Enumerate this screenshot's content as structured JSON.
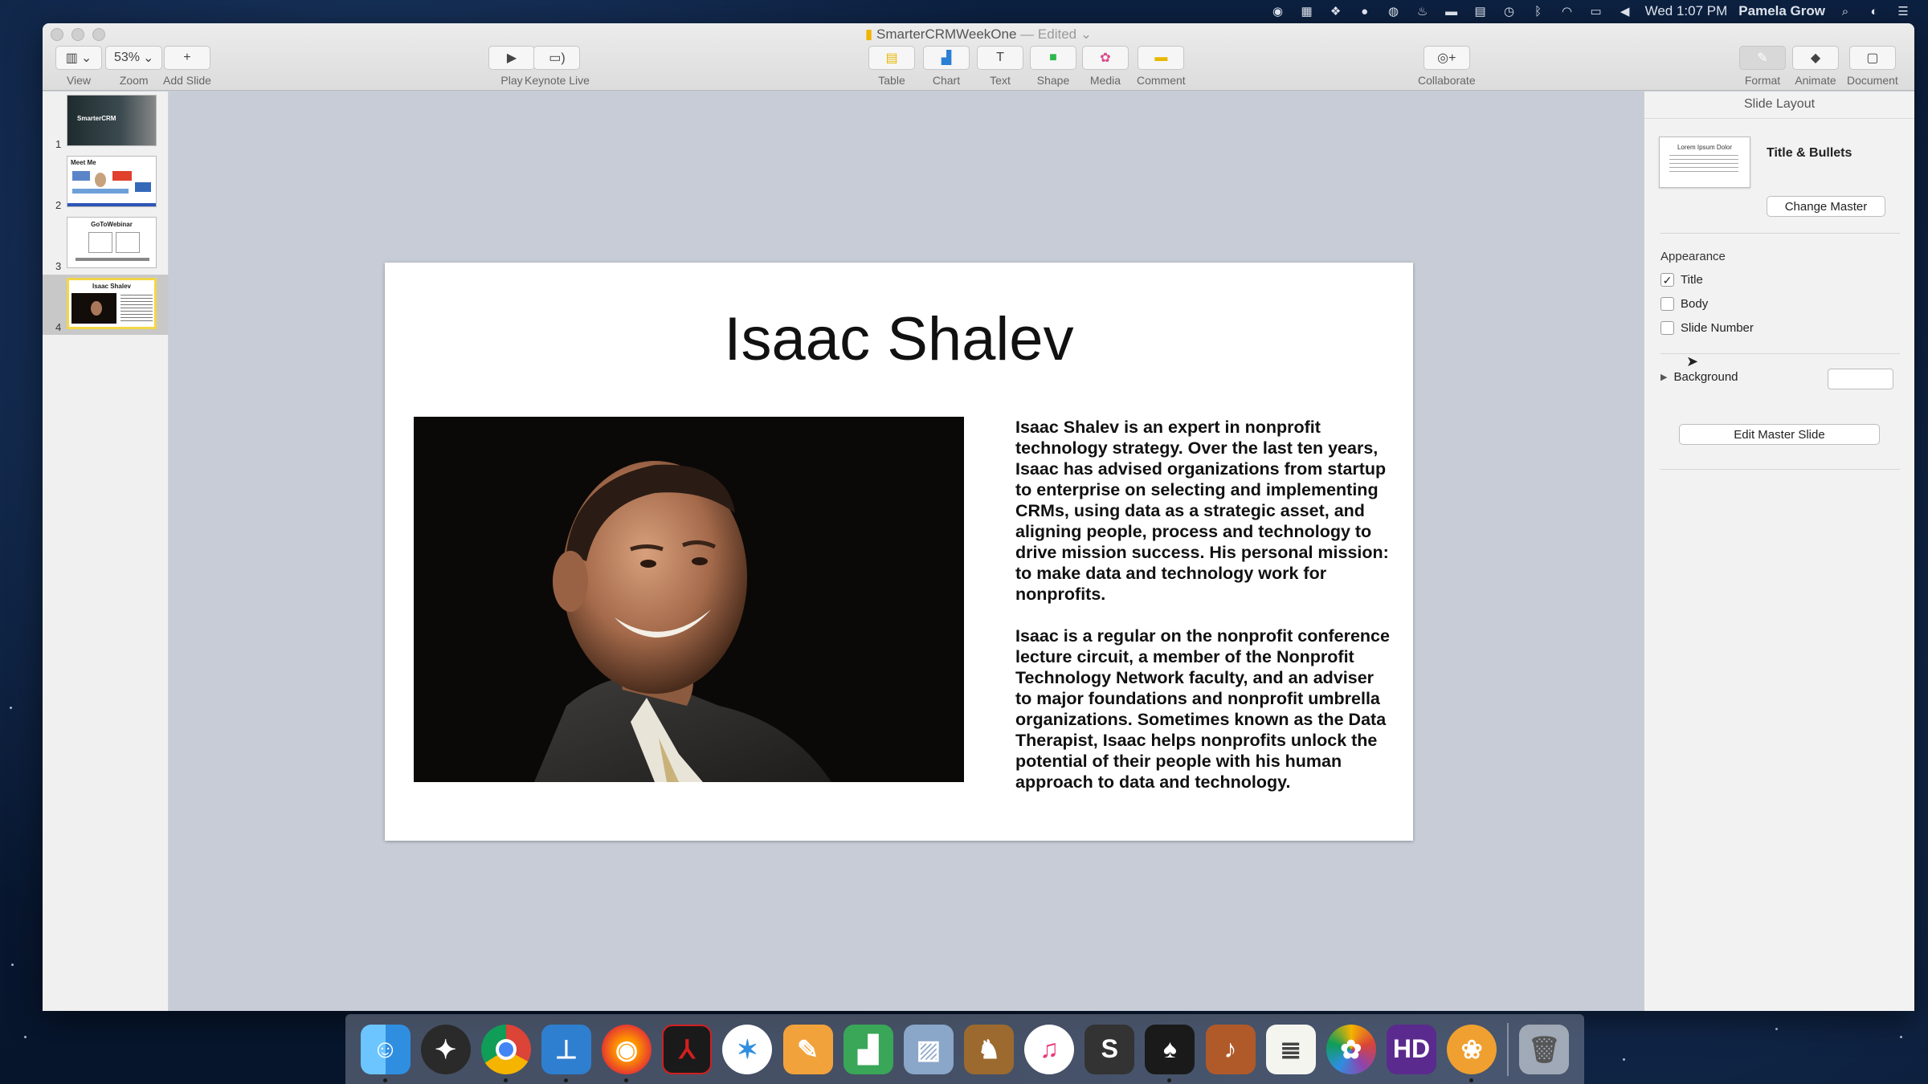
{
  "menubar": {
    "time": "Wed 1:07 PM",
    "user": "Pamela Grow",
    "icons": [
      "creative-cloud-icon",
      "grid-icon",
      "dropbox-icon",
      "circle-icon",
      "recorder-icon",
      "flame-icon",
      "battery-case-icon",
      "book-icon",
      "time-machine-icon",
      "bluetooth-icon",
      "wifi-icon",
      "airplay-icon",
      "volume-icon"
    ]
  },
  "window": {
    "title": "SmarterCRMWeekOne",
    "edited": "— Edited"
  },
  "toolbar": {
    "view": "View",
    "zoom": "Zoom",
    "zoom_value": "53%",
    "add_slide": "Add Slide",
    "play": "Play",
    "keynote_live": "Keynote Live",
    "table": "Table",
    "chart": "Chart",
    "text": "Text",
    "shape": "Shape",
    "media": "Media",
    "comment": "Comment",
    "collaborate": "Collaborate",
    "format": "Format",
    "animate": "Animate",
    "document": "Document"
  },
  "navigator": {
    "slides": [
      {
        "num": "1",
        "title": "SmarterCRM"
      },
      {
        "num": "2",
        "title": "Meet Me"
      },
      {
        "num": "3",
        "title": "GoToWebinar"
      },
      {
        "num": "4",
        "title": "Isaac Shalev"
      }
    ],
    "selected": 4
  },
  "slide": {
    "title": "Isaac Shalev",
    "paragraph1": "Isaac Shalev is an expert in nonprofit technology strategy. Over the last ten years, Isaac has advised organizations from startup to enterprise on selecting and implementing CRMs, using data as a strategic asset, and aligning people, process and technology to drive mission success. His personal mission: to make data and technology work for nonprofits.",
    "paragraph2": "Isaac is a regular on the nonprofit conference lecture circuit, a member of the Nonprofit Technology Network faculty, and an adviser to major foundations and nonprofit umbrella organizations. Sometimes known as the Data Therapist, Isaac helps nonprofits unlock the potential of their people with his human approach to data and technology."
  },
  "inspector": {
    "header": "Slide Layout",
    "layout_name": "Title & Bullets",
    "layout_thumb_text": "Lorem Ipsum Dolor",
    "change_master": "Change Master",
    "appearance": "Appearance",
    "checkboxes": [
      {
        "label": "Title",
        "checked": true
      },
      {
        "label": "Body",
        "checked": false
      },
      {
        "label": "Slide Number",
        "checked": false
      }
    ],
    "background": "Background",
    "edit_master": "Edit Master Slide"
  },
  "dock": {
    "items": [
      "finder-icon",
      "launchpad-icon",
      "chrome-icon",
      "keynote-icon",
      "firefox-icon",
      "acrobat-icon",
      "safari-icon",
      "pages-icon",
      "numbers-icon",
      "preview-icon",
      "transmit-icon",
      "itunes-icon",
      "scrivener-icon",
      "solitaire-icon",
      "garageband-icon",
      "textedit-icon",
      "photos-icon",
      "hd-icon",
      "flower-icon",
      "trash-icon"
    ]
  }
}
